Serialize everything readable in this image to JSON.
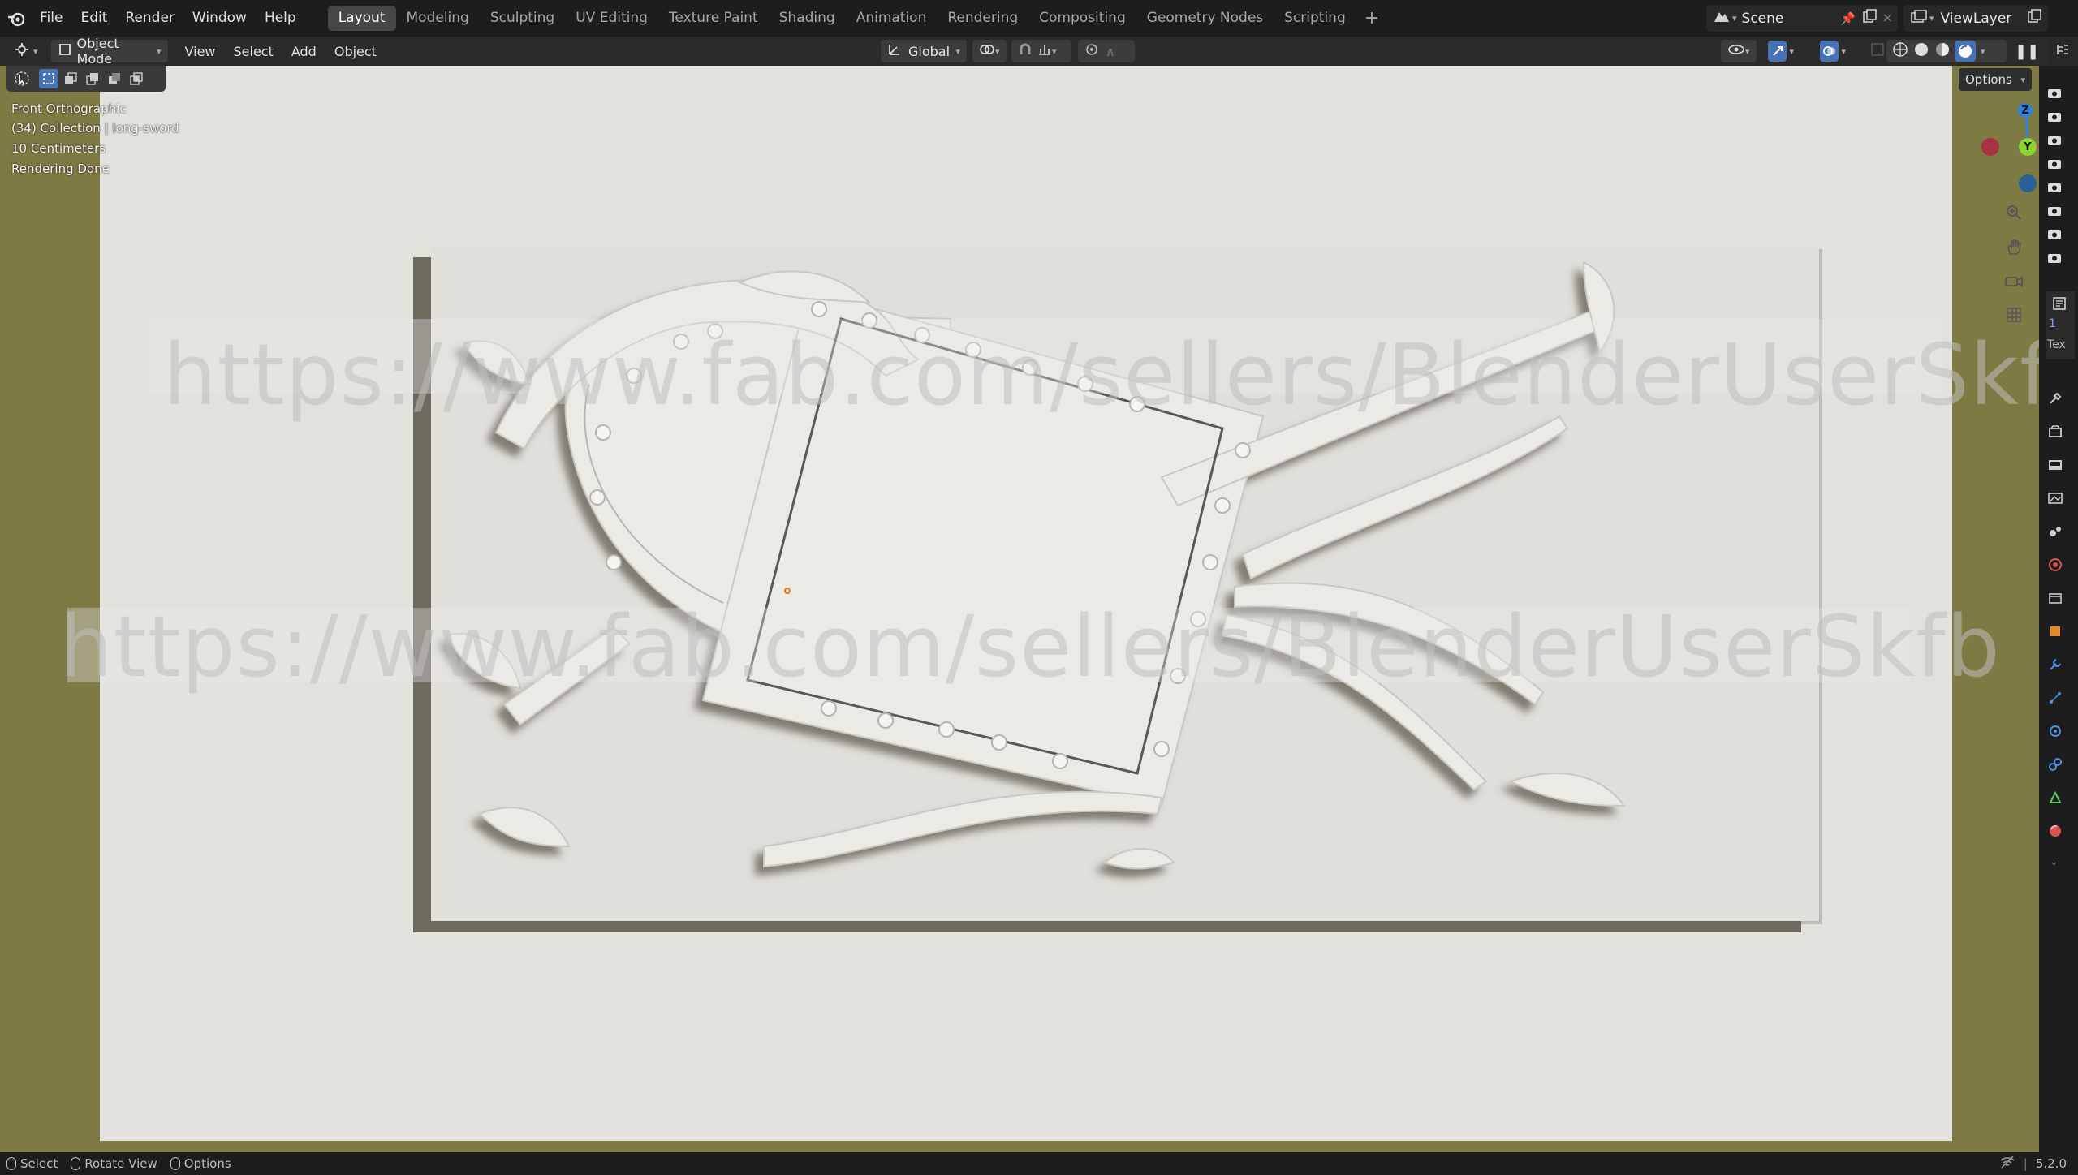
{
  "menu": {
    "items": [
      "File",
      "Edit",
      "Render",
      "Window",
      "Help"
    ]
  },
  "workspaces": {
    "tabs": [
      "Layout",
      "Modeling",
      "Sculpting",
      "UV Editing",
      "Texture Paint",
      "Shading",
      "Animation",
      "Rendering",
      "Compositing",
      "Geometry Nodes",
      "Scripting"
    ],
    "active": "Layout",
    "add_label": "+"
  },
  "scene": {
    "name": "Scene"
  },
  "view_layer": {
    "name": "ViewLayer"
  },
  "header": {
    "mode": "Object Mode",
    "menus": [
      "View",
      "Select",
      "Add",
      "Object"
    ],
    "orientation": "Global",
    "options_label": "Options"
  },
  "viewport": {
    "overlay": {
      "view_name": "Front Orthographic",
      "collection": "(34) Collection | long-sword",
      "scale": "10 Centimeters",
      "status": "Rendering Done"
    },
    "watermark_text": "https://www.fab.com/sellers/BlenderUserSkfb",
    "gizmo": {
      "z": "Z",
      "y": "Y",
      "x": "X"
    }
  },
  "side_panel": {
    "number": "1",
    "tab_label": "Tex"
  },
  "status_bar": {
    "select": "Select",
    "rotate": "Rotate View",
    "options": "Options",
    "version": "5.2.0"
  },
  "colors": {
    "viewport_bg": "#7e7a44",
    "render_bg": "#e2e1dc",
    "accent": "#4772b3",
    "x_axis": "#e2394f",
    "y_axis": "#8bd32f",
    "z_axis": "#2f83e0"
  }
}
